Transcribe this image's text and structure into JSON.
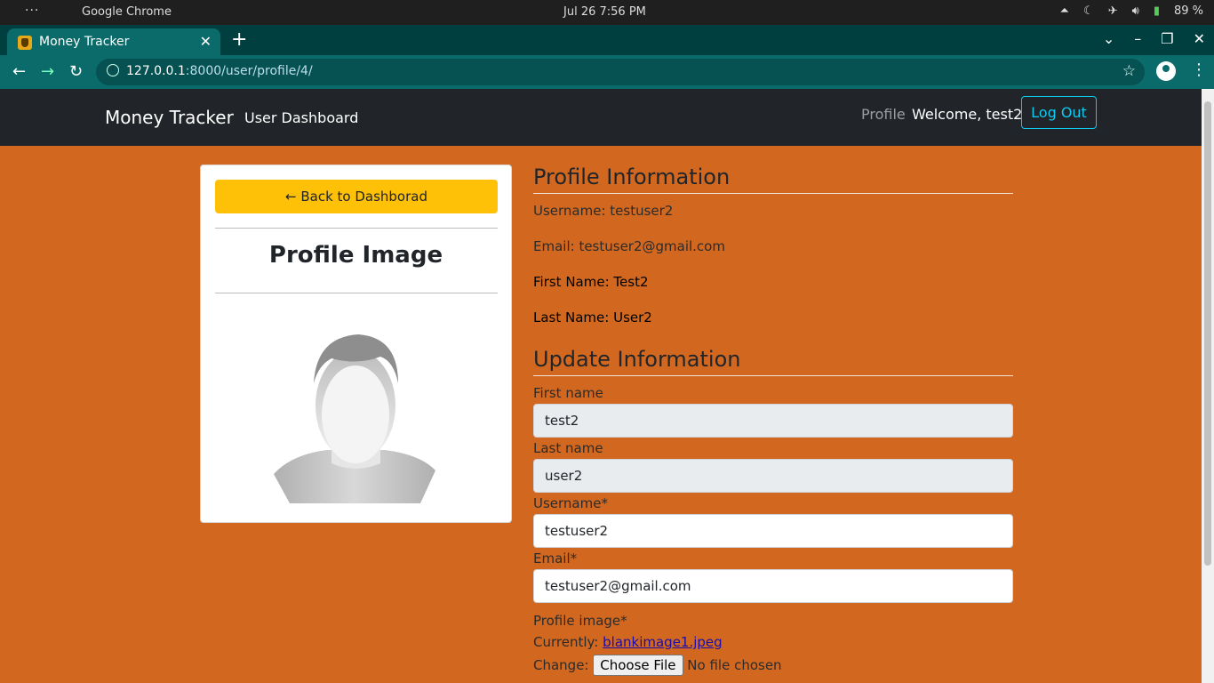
{
  "os": {
    "dots": "···",
    "app_name": "Google Chrome",
    "datetime": "Jul 26   7:56 PM",
    "battery": "89 %"
  },
  "browser": {
    "tab_title": "Money Tracker",
    "url_host": "127.0.0.1",
    "url_path": ":8000/user/profile/4/"
  },
  "navbar": {
    "brand": "Money Tracker",
    "dashboard_link": "User Dashboard",
    "profile_link": "Profile",
    "welcome": "Welcome, test2",
    "logout": "Log Out"
  },
  "card": {
    "back_button": "← Back to Dashborad",
    "heading": "Profile Image"
  },
  "profile": {
    "heading": "Profile Information",
    "username": "Username: testuser2",
    "email": "Email: testuser2@gmail.com",
    "first_name": "First Name: Test2",
    "last_name": "Last Name: User2"
  },
  "form": {
    "heading": "Update Information",
    "first_name_label": "First name",
    "first_name_value": "test2",
    "last_name_label": "Last name",
    "last_name_value": "user2",
    "username_label": "Username*",
    "username_value": "testuser2",
    "email_label": "Email*",
    "email_value": "testuser2@gmail.com",
    "profile_image_label": "Profile image*",
    "currently_label": "Currently:",
    "current_file": "blankimage1.jpeg",
    "change_label": "Change:",
    "choose_file": "Choose File",
    "no_file": "No file chosen"
  }
}
